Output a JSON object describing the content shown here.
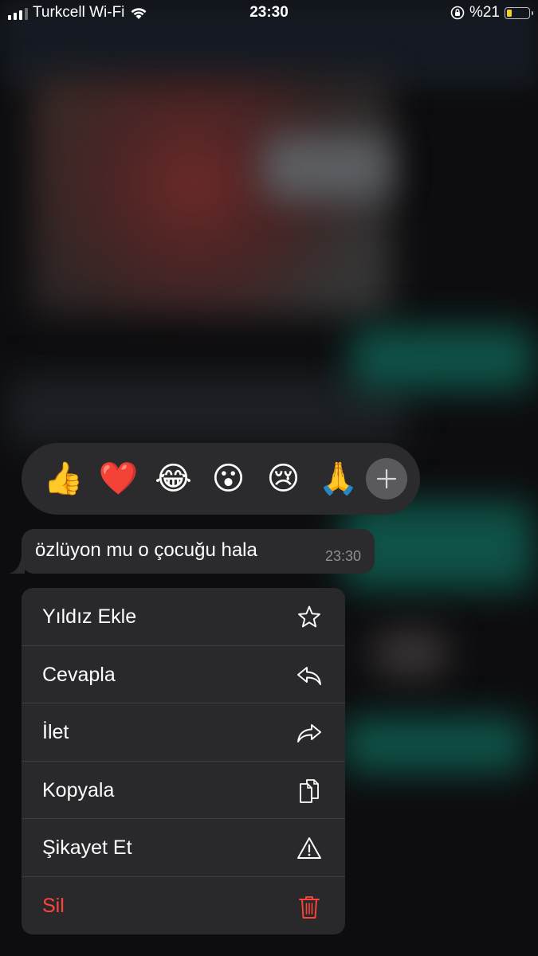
{
  "status_bar": {
    "carrier": "Turkcell Wi-Fi",
    "time": "23:30",
    "battery_text": "%21",
    "battery_level": 0.21,
    "battery_color": "#f7cf2e"
  },
  "reactions": [
    {
      "emoji": "👍",
      "icon": "thumbs-up"
    },
    {
      "emoji": "❤️",
      "icon": "red-heart"
    },
    {
      "emoji": "😂",
      "icon": "tears-of-joy"
    },
    {
      "emoji": "😮",
      "icon": "surprised-face"
    },
    {
      "emoji": "😢",
      "icon": "crying-face"
    },
    {
      "emoji": "🙏",
      "icon": "folded-hands"
    }
  ],
  "message": {
    "text": "özlüyon mu o çocuğu hala",
    "time": "23:30"
  },
  "menu": {
    "items": [
      {
        "label": "Yıldız Ekle",
        "icon": "star-icon"
      },
      {
        "label": "Cevapla",
        "icon": "reply-icon"
      },
      {
        "label": "İlet",
        "icon": "forward-icon"
      },
      {
        "label": "Kopyala",
        "icon": "copy-icon"
      },
      {
        "label": "Şikayet Et",
        "icon": "warning-icon"
      },
      {
        "label": "Sil",
        "icon": "trash-icon",
        "danger": true,
        "color": "#ff453a"
      }
    ]
  }
}
